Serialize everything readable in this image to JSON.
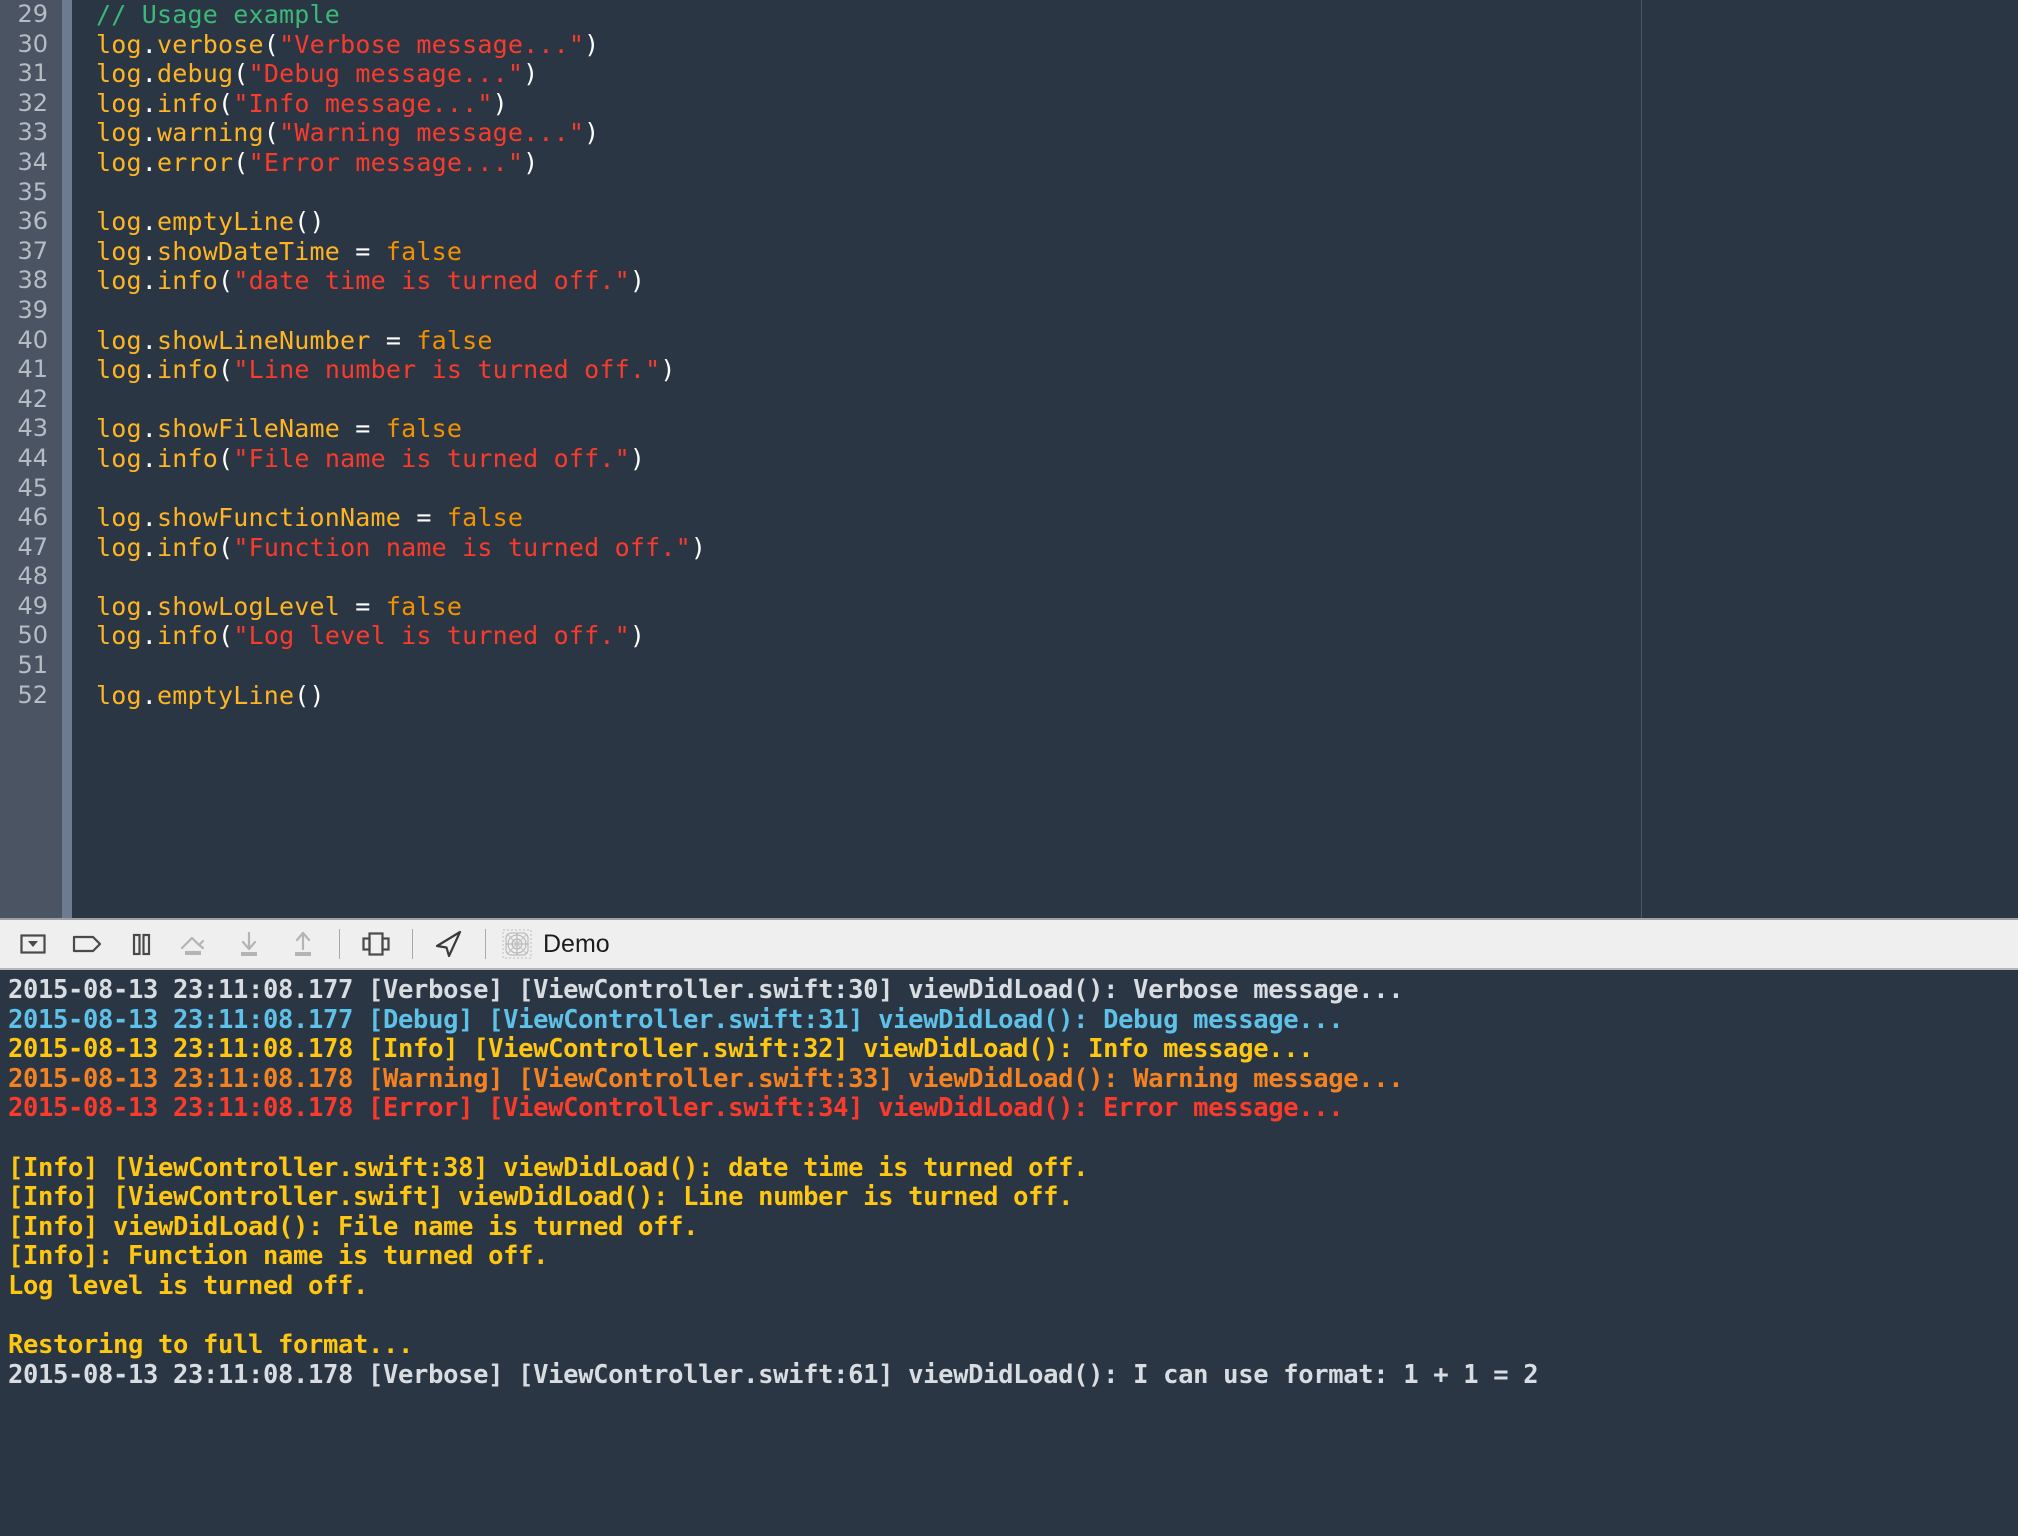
{
  "editor": {
    "language": "swift",
    "background_color": "#2b3644",
    "gutter_color": "#4a5463",
    "page_guide_color": "#4d586a",
    "first_visible_line": 29,
    "last_visible_line": 52,
    "lines": [
      {
        "number": "29",
        "tokens": [
          {
            "t": "comment",
            "v": "// Usage example"
          }
        ]
      },
      {
        "number": "30",
        "tokens": [
          {
            "t": "id",
            "v": "log"
          },
          {
            "t": "pun",
            "v": "."
          },
          {
            "t": "id",
            "v": "verbose"
          },
          {
            "t": "pun",
            "v": "("
          },
          {
            "t": "str",
            "v": "\"Verbose message...\""
          },
          {
            "t": "pun",
            "v": ")"
          }
        ]
      },
      {
        "number": "31",
        "tokens": [
          {
            "t": "id",
            "v": "log"
          },
          {
            "t": "pun",
            "v": "."
          },
          {
            "t": "id",
            "v": "debug"
          },
          {
            "t": "pun",
            "v": "("
          },
          {
            "t": "str",
            "v": "\"Debug message...\""
          },
          {
            "t": "pun",
            "v": ")"
          }
        ]
      },
      {
        "number": "32",
        "tokens": [
          {
            "t": "id",
            "v": "log"
          },
          {
            "t": "pun",
            "v": "."
          },
          {
            "t": "id",
            "v": "info"
          },
          {
            "t": "pun",
            "v": "("
          },
          {
            "t": "str",
            "v": "\"Info message...\""
          },
          {
            "t": "pun",
            "v": ")"
          }
        ]
      },
      {
        "number": "33",
        "tokens": [
          {
            "t": "id",
            "v": "log"
          },
          {
            "t": "pun",
            "v": "."
          },
          {
            "t": "id",
            "v": "warning"
          },
          {
            "t": "pun",
            "v": "("
          },
          {
            "t": "str",
            "v": "\"Warning message...\""
          },
          {
            "t": "pun",
            "v": ")"
          }
        ]
      },
      {
        "number": "34",
        "tokens": [
          {
            "t": "id",
            "v": "log"
          },
          {
            "t": "pun",
            "v": "."
          },
          {
            "t": "id",
            "v": "error"
          },
          {
            "t": "pun",
            "v": "("
          },
          {
            "t": "str",
            "v": "\"Error message...\""
          },
          {
            "t": "pun",
            "v": ")"
          }
        ]
      },
      {
        "number": "35",
        "tokens": []
      },
      {
        "number": "36",
        "tokens": [
          {
            "t": "id",
            "v": "log"
          },
          {
            "t": "pun",
            "v": "."
          },
          {
            "t": "id",
            "v": "emptyLine"
          },
          {
            "t": "pun",
            "v": "()"
          }
        ]
      },
      {
        "number": "37",
        "tokens": [
          {
            "t": "id",
            "v": "log"
          },
          {
            "t": "pun",
            "v": "."
          },
          {
            "t": "id",
            "v": "showDateTime"
          },
          {
            "t": "op",
            "v": " = "
          },
          {
            "t": "kw",
            "v": "false"
          }
        ]
      },
      {
        "number": "38",
        "tokens": [
          {
            "t": "id",
            "v": "log"
          },
          {
            "t": "pun",
            "v": "."
          },
          {
            "t": "id",
            "v": "info"
          },
          {
            "t": "pun",
            "v": "("
          },
          {
            "t": "str",
            "v": "\"date time is turned off.\""
          },
          {
            "t": "pun",
            "v": ")"
          }
        ]
      },
      {
        "number": "39",
        "tokens": []
      },
      {
        "number": "40",
        "tokens": [
          {
            "t": "id",
            "v": "log"
          },
          {
            "t": "pun",
            "v": "."
          },
          {
            "t": "id",
            "v": "showLineNumber"
          },
          {
            "t": "op",
            "v": " = "
          },
          {
            "t": "kw",
            "v": "false"
          }
        ]
      },
      {
        "number": "41",
        "tokens": [
          {
            "t": "id",
            "v": "log"
          },
          {
            "t": "pun",
            "v": "."
          },
          {
            "t": "id",
            "v": "info"
          },
          {
            "t": "pun",
            "v": "("
          },
          {
            "t": "str",
            "v": "\"Line number is turned off.\""
          },
          {
            "t": "pun",
            "v": ")"
          }
        ]
      },
      {
        "number": "42",
        "tokens": []
      },
      {
        "number": "43",
        "tokens": [
          {
            "t": "id",
            "v": "log"
          },
          {
            "t": "pun",
            "v": "."
          },
          {
            "t": "id",
            "v": "showFileName"
          },
          {
            "t": "op",
            "v": " = "
          },
          {
            "t": "kw",
            "v": "false"
          }
        ]
      },
      {
        "number": "44",
        "tokens": [
          {
            "t": "id",
            "v": "log"
          },
          {
            "t": "pun",
            "v": "."
          },
          {
            "t": "id",
            "v": "info"
          },
          {
            "t": "pun",
            "v": "("
          },
          {
            "t": "str",
            "v": "\"File name is turned off.\""
          },
          {
            "t": "pun",
            "v": ")"
          }
        ]
      },
      {
        "number": "45",
        "tokens": []
      },
      {
        "number": "46",
        "tokens": [
          {
            "t": "id",
            "v": "log"
          },
          {
            "t": "pun",
            "v": "."
          },
          {
            "t": "id",
            "v": "showFunctionName"
          },
          {
            "t": "op",
            "v": " = "
          },
          {
            "t": "kw",
            "v": "false"
          }
        ]
      },
      {
        "number": "47",
        "tokens": [
          {
            "t": "id",
            "v": "log"
          },
          {
            "t": "pun",
            "v": "."
          },
          {
            "t": "id",
            "v": "info"
          },
          {
            "t": "pun",
            "v": "("
          },
          {
            "t": "str",
            "v": "\"Function name is turned off.\""
          },
          {
            "t": "pun",
            "v": ")"
          }
        ]
      },
      {
        "number": "48",
        "tokens": []
      },
      {
        "number": "49",
        "tokens": [
          {
            "t": "id",
            "v": "log"
          },
          {
            "t": "pun",
            "v": "."
          },
          {
            "t": "id",
            "v": "showLogLevel"
          },
          {
            "t": "op",
            "v": " = "
          },
          {
            "t": "kw",
            "v": "false"
          }
        ]
      },
      {
        "number": "50",
        "tokens": [
          {
            "t": "id",
            "v": "log"
          },
          {
            "t": "pun",
            "v": "."
          },
          {
            "t": "id",
            "v": "info"
          },
          {
            "t": "pun",
            "v": "("
          },
          {
            "t": "str",
            "v": "\"Log level is turned off.\""
          },
          {
            "t": "pun",
            "v": ")"
          }
        ]
      },
      {
        "number": "51",
        "tokens": []
      },
      {
        "number": "52",
        "tokens": [
          {
            "t": "id",
            "v": "log"
          },
          {
            "t": "pun",
            "v": "."
          },
          {
            "t": "id",
            "v": "emptyLine"
          },
          {
            "t": "pun",
            "v": "()"
          }
        ]
      }
    ]
  },
  "toolbar": {
    "background_color": "#efefef",
    "buttons": [
      {
        "icon": "hide-debug-area-icon",
        "label": "Hide Debug Area",
        "enabled": true
      },
      {
        "icon": "breakpoints-icon",
        "label": "Activate Breakpoints",
        "enabled": true
      },
      {
        "icon": "pause-icon",
        "label": "Pause Program Execution",
        "enabled": true
      },
      {
        "icon": "step-over-icon",
        "label": "Step Over",
        "enabled": false
      },
      {
        "icon": "step-into-icon",
        "label": "Step Into",
        "enabled": false
      },
      {
        "icon": "step-out-icon",
        "label": "Step Out",
        "enabled": false
      },
      {
        "icon": "debug-view-hierarchy-icon",
        "label": "Debug View Hierarchy",
        "enabled": true
      },
      {
        "icon": "simulate-location-icon",
        "label": "Simulate Location",
        "enabled": true
      }
    ],
    "process_icon": "app-thread-icon",
    "process_label": "Demo"
  },
  "console": {
    "background_color": "#2b3644",
    "lines": [
      {
        "level": "verbose",
        "text": "2015-08-13 23:11:08.177 [Verbose] [ViewController.swift:30] viewDidLoad(): Verbose message..."
      },
      {
        "level": "debug",
        "text": "2015-08-13 23:11:08.177 [Debug] [ViewController.swift:31] viewDidLoad(): Debug message..."
      },
      {
        "level": "info",
        "text": "2015-08-13 23:11:08.178 [Info] [ViewController.swift:32] viewDidLoad(): Info message..."
      },
      {
        "level": "warning",
        "text": "2015-08-13 23:11:08.178 [Warning] [ViewController.swift:33] viewDidLoad(): Warning message..."
      },
      {
        "level": "error",
        "text": "2015-08-13 23:11:08.178 [Error] [ViewController.swift:34] viewDidLoad(): Error message..."
      },
      {
        "level": "blank",
        "text": " "
      },
      {
        "level": "info",
        "text": "[Info] [ViewController.swift:38] viewDidLoad(): date time is turned off."
      },
      {
        "level": "info",
        "text": "[Info] [ViewController.swift] viewDidLoad(): Line number is turned off."
      },
      {
        "level": "info",
        "text": "[Info] viewDidLoad(): File name is turned off."
      },
      {
        "level": "info",
        "text": "[Info]: Function name is turned off."
      },
      {
        "level": "info",
        "text": "Log level is turned off."
      },
      {
        "level": "blank",
        "text": " "
      },
      {
        "level": "info",
        "text": "Restoring to full format..."
      },
      {
        "level": "verbose",
        "text": "2015-08-13 23:11:08.178 [Verbose] [ViewController.swift:61] viewDidLoad(): I can use format: 1 + 1 = 2"
      }
    ]
  },
  "colors": {
    "comment": "#3cb878",
    "identifier": "#ffb521",
    "string": "#fa3b2c",
    "keyword": "#f39200",
    "punctuation": "#ffffff",
    "level_verbose": "#d9dde2",
    "level_debug": "#5ec1e8",
    "level_info": "#ffc710",
    "level_warning": "#f58220",
    "level_error": "#fa3b2c"
  }
}
